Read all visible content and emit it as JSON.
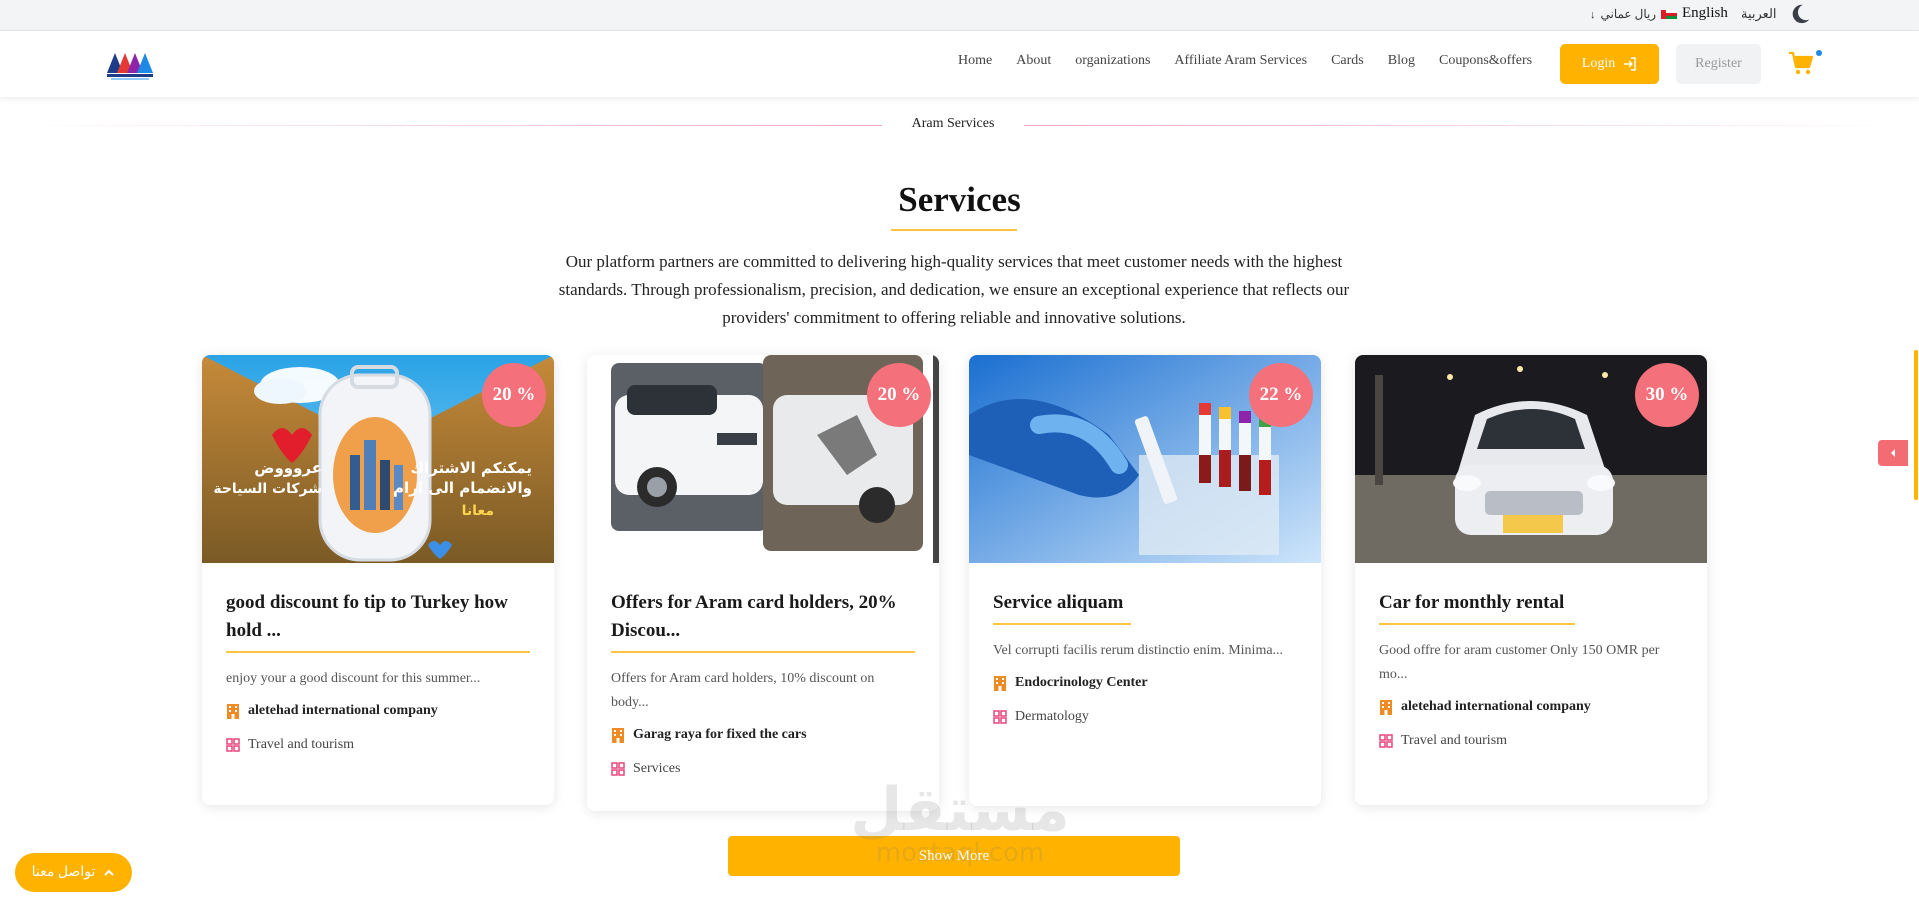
{
  "topbar": {
    "lang_ar": "العربية",
    "lang_en": "English",
    "currency": "ريال عماني"
  },
  "nav": {
    "links": [
      "Home",
      "About",
      "organizations",
      "Affiliate Aram Services",
      "Cards",
      "Blog",
      "Coupons&offers"
    ],
    "login": "Login",
    "register": "Register"
  },
  "section": {
    "label": "Aram Services",
    "title": "Services",
    "description": "Our platform partners are committed to delivering high-quality services that meet customer needs with the highest standards. Through professionalism, precision, and dedication, we ensure an exceptional experience that reflects our providers' commitment to offering reliable and innovative solutions."
  },
  "cards": [
    {
      "discount": "20 %",
      "title": "good discount fo tip to Turkey how hold ...",
      "description": "enjoy your a good discount for this summer...",
      "company": "aletehad international company",
      "category": "Travel and tourism",
      "image_text_1": "يمكنكم الاشتراك",
      "image_text_2": "والانضمام الى ارام",
      "image_text_3": "معانا",
      "image_text_4": "عروووض",
      "image_text_5": "شركات السياحة"
    },
    {
      "discount": "20 %",
      "title": "Offers for Aram card holders, 20% Discou...",
      "description": "Offers for Aram card holders, 10% discount on body...",
      "company": "Garag raya for fixed the cars",
      "category": "Services"
    },
    {
      "discount": "22 %",
      "title": "Service aliquam",
      "description": "Vel corrupti facilis rerum distinctio enim. Minima...",
      "company": "Endocrinology Center",
      "category": "Dermatology"
    },
    {
      "discount": "30 %",
      "title": "Car for monthly rental",
      "description": "Good offre for aram customer Only 150 OMR per mo...",
      "company": "aletehad international company",
      "category": "Travel and tourism"
    }
  ],
  "show_more": "Show More",
  "contact": "تواصل معنا",
  "watermark": {
    "line1": "مستقل",
    "line2": "mostaql.com"
  },
  "colors": {
    "accent": "#ffb300",
    "badge": "#f4707a",
    "underline": "#ffc440"
  }
}
